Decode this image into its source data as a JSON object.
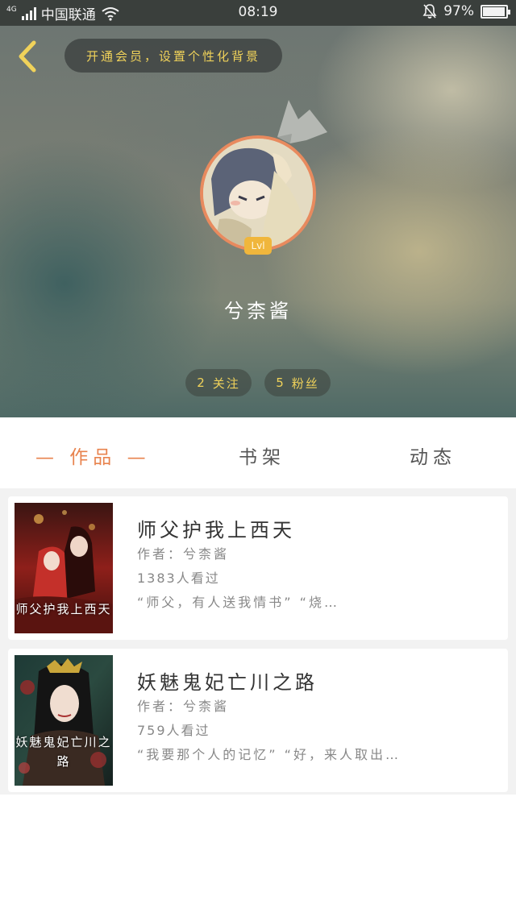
{
  "status_bar": {
    "network": "4G",
    "carrier": "中国联通",
    "time": "08:19",
    "battery": "97%",
    "battery_level": 0.97
  },
  "header": {
    "vip_prompt": "开通会员，设置个性化背景",
    "level": "Lvl",
    "username": "兮柰酱",
    "following": {
      "count": "2",
      "label": "关注"
    },
    "fans": {
      "count": "5",
      "label": "粉丝"
    }
  },
  "tabs": [
    {
      "label": "— 作品 —",
      "active": true
    },
    {
      "label": "书架",
      "active": false
    },
    {
      "label": "动态",
      "active": false
    }
  ],
  "books": [
    {
      "title": "师父护我上西天",
      "author": "作者：兮柰酱",
      "views": "1383人看过",
      "excerpt": "“师父，有人送我情书” “烧…",
      "cover_text": "师父护我上西天"
    },
    {
      "title": "妖魅鬼妃亡川之路",
      "author": "作者：兮柰酱",
      "views": "759人看过",
      "excerpt": "“我要那个人的记忆” “好，来人取出…",
      "cover_text": "妖魅鬼妃亡川之路"
    }
  ],
  "colors": {
    "accent": "#e8834e",
    "gold": "#f0d25a",
    "level_badge": "#f0b63c"
  }
}
